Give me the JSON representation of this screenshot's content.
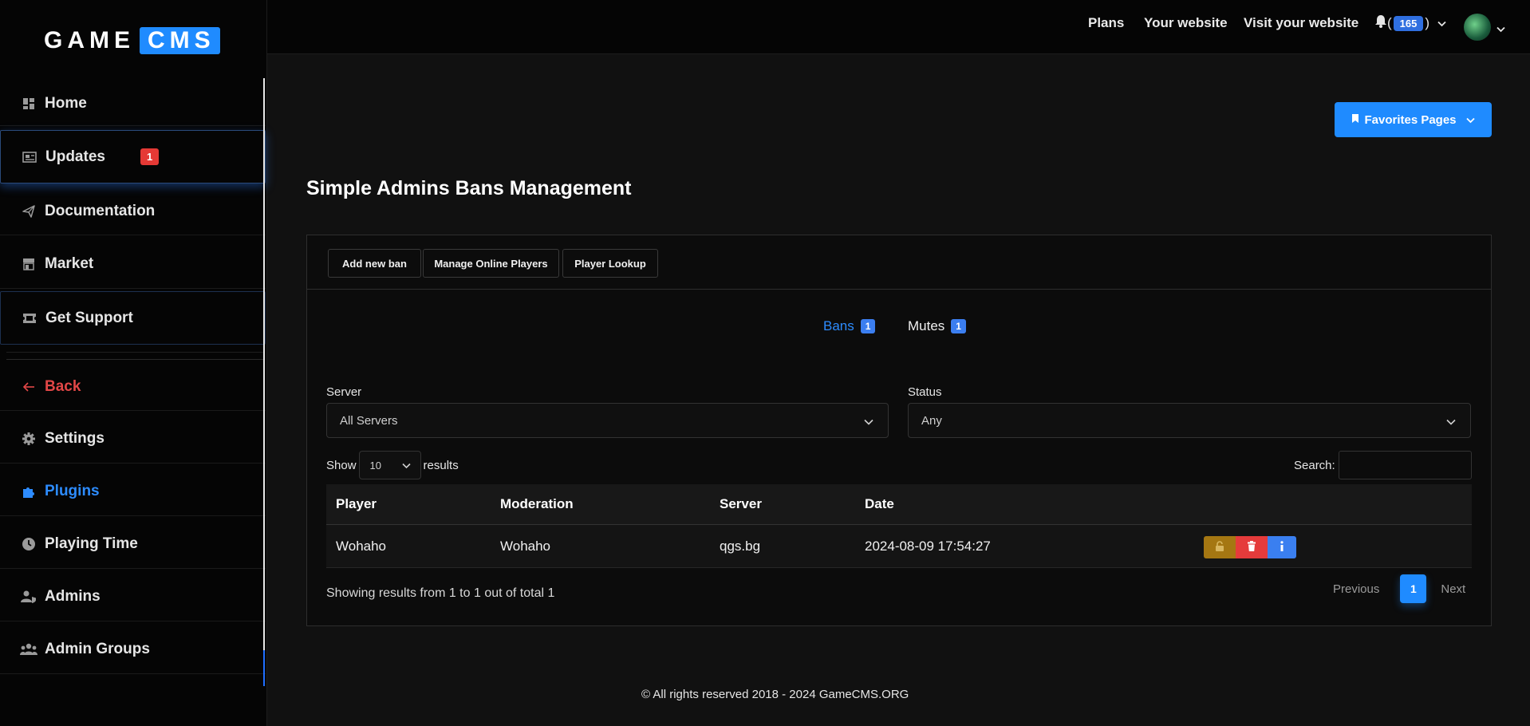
{
  "logo": {
    "part1": "GAME",
    "part2": "CMS"
  },
  "sidebar": {
    "items": [
      {
        "label": "Home",
        "icon": "dashboard-icon"
      },
      {
        "label": "Updates",
        "icon": "newspaper-icon",
        "badge": "1"
      },
      {
        "label": "Documentation",
        "icon": "paper-plane-icon"
      },
      {
        "label": "Market",
        "icon": "store-icon"
      },
      {
        "label": "Get Support",
        "icon": "ticket-icon"
      },
      {
        "label": "Back",
        "icon": "arrow-left-icon"
      },
      {
        "label": "Settings",
        "icon": "gear-icon"
      },
      {
        "label": "Plugins",
        "icon": "puzzle-icon"
      },
      {
        "label": "Playing Time",
        "icon": "clock-icon"
      },
      {
        "label": "Admins",
        "icon": "user-shield-icon"
      },
      {
        "label": "Admin Groups",
        "icon": "users-icon"
      }
    ]
  },
  "topbar": {
    "links": [
      "Plans",
      "Your website",
      "Visit your website"
    ],
    "notifications_count": "165",
    "paren_open": "(",
    "paren_close": ")"
  },
  "favorites_button": "Favorites Pages",
  "page_title": "Simple Admins Bans Management",
  "toolbar": {
    "add_ban": "Add new ban",
    "manage_online": "Manage Online Players",
    "player_lookup": "Player Lookup"
  },
  "tabs": [
    {
      "label": "Bans",
      "count": "1"
    },
    {
      "label": "Mutes",
      "count": "1"
    }
  ],
  "filters": {
    "server_label": "Server",
    "server_value": "All Servers",
    "status_label": "Status",
    "status_value": "Any"
  },
  "table_controls": {
    "show": "Show",
    "length": "10",
    "results": "results",
    "search_label": "Search:"
  },
  "table": {
    "headers": [
      "Player",
      "Moderation",
      "Server",
      "Date"
    ],
    "rows": [
      {
        "player": "Wohaho",
        "moderation": "Wohaho",
        "server": "qgs.bg",
        "date": "2024-08-09 17:54:27"
      }
    ]
  },
  "summary": "Showing results from 1 to 1 out of total 1",
  "pagination": {
    "previous": "Previous",
    "current": "1",
    "next": "Next"
  },
  "footer": "© All rights reserved 2018 - 2024 GameCMS.ORG",
  "colors": {
    "accent": "#1f8bff",
    "danger": "#e53b3b",
    "warning": "#a57712"
  }
}
